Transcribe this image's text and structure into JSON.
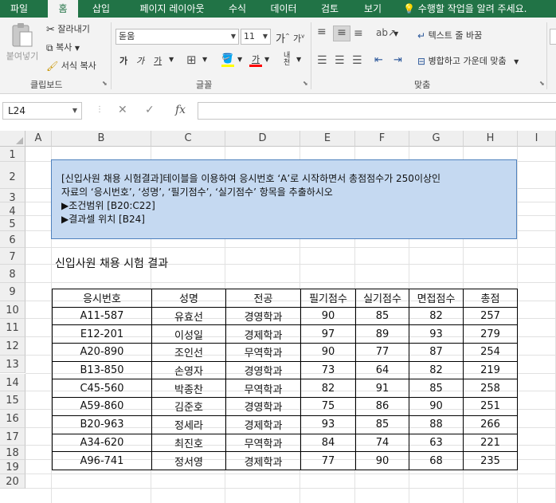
{
  "menu": {
    "tabs": [
      "파일",
      "홈",
      "삽입",
      "페이지 레이아웃",
      "수식",
      "데이터",
      "검토",
      "보기"
    ],
    "tell_me": "수행할 작업을 알려 주세요."
  },
  "ribbon": {
    "clipboard": {
      "paste": "붙여넣기",
      "cut": "잘라내기",
      "copy": "복사",
      "format_painter": "서식 복사",
      "label": "클립보드"
    },
    "font": {
      "name": "돋움",
      "size": "11",
      "label": "글꼴"
    },
    "alignment": {
      "wrap_text": "텍스트 줄 바꿈",
      "merge_center": "병합하고 가운데 맞춤",
      "label": "맞춤"
    }
  },
  "formula_bar": {
    "name_box": "L24",
    "formula": ""
  },
  "columns": [
    "A",
    "B",
    "C",
    "D",
    "E",
    "F",
    "G",
    "H",
    "I"
  ],
  "rows": [
    "1",
    "2",
    "3",
    "4",
    "5",
    "6",
    "7",
    "8",
    "9",
    "10",
    "11",
    "12",
    "13",
    "14",
    "15",
    "16",
    "17",
    "18",
    "19",
    "20"
  ],
  "note": {
    "line1": "[신입사원 채용 시험결과]테이블을 이용하여 응시번호 ‘A’로 시작하면서 총점점수가 250이상인",
    "line2": "자료의 ‘응시번호’, ‘성명’, ‘필기점수’, ‘실기점수’ 항목을 추출하시오",
    "line3": "▶조건범위 [B20:C22]",
    "line4": "▶결과셀 위치 [B24]"
  },
  "sheet_title": "신입사원 채용 시험 결과",
  "table": {
    "headers": [
      "응시번호",
      "성명",
      "전공",
      "필기점수",
      "실기점수",
      "면접점수",
      "총점"
    ],
    "rows": [
      [
        "A11-587",
        "유효선",
        "경영학과",
        "90",
        "85",
        "82",
        "257"
      ],
      [
        "E12-201",
        "이성일",
        "경제학과",
        "97",
        "89",
        "93",
        "279"
      ],
      [
        "A20-890",
        "조인선",
        "무역학과",
        "90",
        "77",
        "87",
        "254"
      ],
      [
        "B13-850",
        "손영자",
        "경영학과",
        "73",
        "64",
        "82",
        "219"
      ],
      [
        "C45-560",
        "박종찬",
        "무역학과",
        "82",
        "91",
        "85",
        "258"
      ],
      [
        "A59-860",
        "김준호",
        "경영학과",
        "75",
        "86",
        "90",
        "251"
      ],
      [
        "B20-963",
        "정세라",
        "경제학과",
        "93",
        "85",
        "88",
        "266"
      ],
      [
        "A34-620",
        "최진호",
        "무역학과",
        "84",
        "74",
        "63",
        "221"
      ],
      [
        "A96-741",
        "정서영",
        "경제학과",
        "77",
        "90",
        "68",
        "235"
      ]
    ]
  },
  "colors": {
    "excel_green": "#217346",
    "note_fill": "#c5d9f1",
    "note_border": "#4f81bd"
  }
}
